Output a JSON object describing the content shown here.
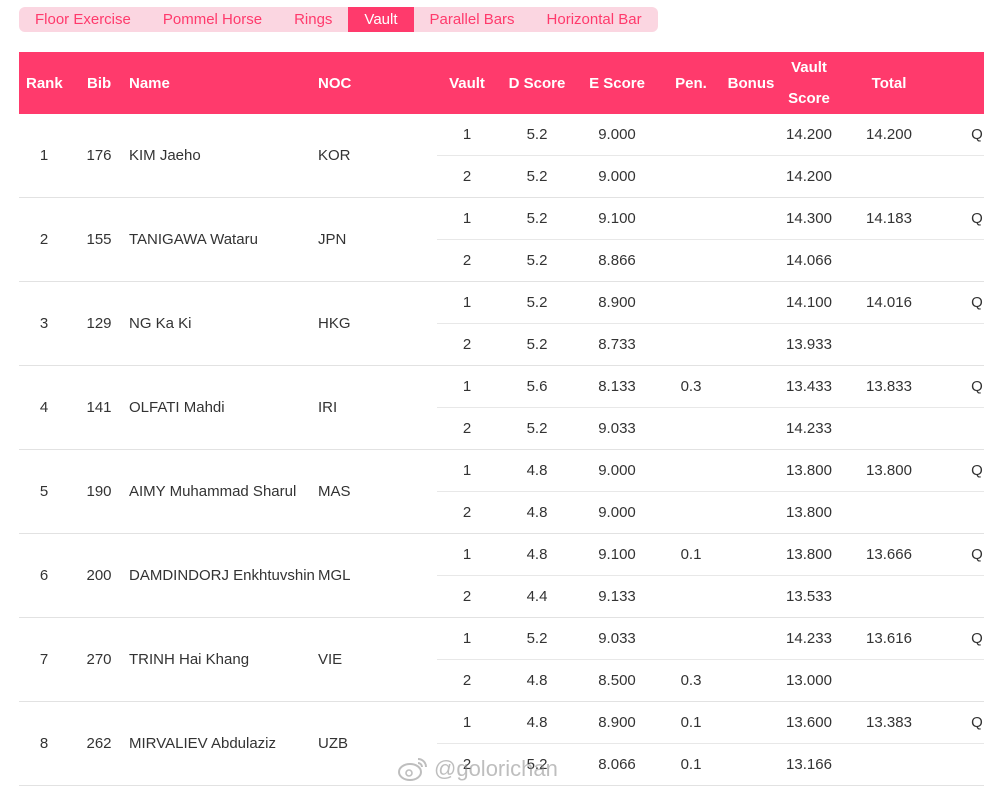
{
  "tabs": [
    {
      "label": "Floor Exercise",
      "active": false
    },
    {
      "label": "Pommel Horse",
      "active": false
    },
    {
      "label": "Rings",
      "active": false
    },
    {
      "label": "Vault",
      "active": true
    },
    {
      "label": "Parallel Bars",
      "active": false
    },
    {
      "label": "Horizontal Bar",
      "active": false
    }
  ],
  "header": {
    "rank": "Rank",
    "bib": "Bib",
    "name": "Name",
    "noc": "NOC",
    "vault": "Vault",
    "d_score": "D Score",
    "e_score": "E Score",
    "pen": "Pen.",
    "bonus": "Bonus",
    "vault_score_line1": "Vault",
    "vault_score_line2": "Score",
    "total": "Total"
  },
  "rows": [
    {
      "rank": "1",
      "bib": "176",
      "name": "KIM Jaeho",
      "noc": "KOR",
      "total": "14.200",
      "qual": "Q",
      "vaults": [
        {
          "vault": "1",
          "d": "5.2",
          "e": "9.000",
          "pen": "",
          "bonus": "",
          "score": "14.200"
        },
        {
          "vault": "2",
          "d": "5.2",
          "e": "9.000",
          "pen": "",
          "bonus": "",
          "score": "14.200"
        }
      ]
    },
    {
      "rank": "2",
      "bib": "155",
      "name": "TANIGAWA Wataru",
      "noc": "JPN",
      "total": "14.183",
      "qual": "Q",
      "vaults": [
        {
          "vault": "1",
          "d": "5.2",
          "e": "9.100",
          "pen": "",
          "bonus": "",
          "score": "14.300"
        },
        {
          "vault": "2",
          "d": "5.2",
          "e": "8.866",
          "pen": "",
          "bonus": "",
          "score": "14.066"
        }
      ]
    },
    {
      "rank": "3",
      "bib": "129",
      "name": "NG Ka Ki",
      "noc": "HKG",
      "total": "14.016",
      "qual": "Q",
      "vaults": [
        {
          "vault": "1",
          "d": "5.2",
          "e": "8.900",
          "pen": "",
          "bonus": "",
          "score": "14.100"
        },
        {
          "vault": "2",
          "d": "5.2",
          "e": "8.733",
          "pen": "",
          "bonus": "",
          "score": "13.933"
        }
      ]
    },
    {
      "rank": "4",
      "bib": "141",
      "name": "OLFATI Mahdi",
      "noc": "IRI",
      "total": "13.833",
      "qual": "Q",
      "vaults": [
        {
          "vault": "1",
          "d": "5.6",
          "e": "8.133",
          "pen": "0.3",
          "bonus": "",
          "score": "13.433"
        },
        {
          "vault": "2",
          "d": "5.2",
          "e": "9.033",
          "pen": "",
          "bonus": "",
          "score": "14.233"
        }
      ]
    },
    {
      "rank": "5",
      "bib": "190",
      "name": "AIMY Muhammad Sharul",
      "noc": "MAS",
      "total": "13.800",
      "qual": "Q",
      "vaults": [
        {
          "vault": "1",
          "d": "4.8",
          "e": "9.000",
          "pen": "",
          "bonus": "",
          "score": "13.800"
        },
        {
          "vault": "2",
          "d": "4.8",
          "e": "9.000",
          "pen": "",
          "bonus": "",
          "score": "13.800"
        }
      ]
    },
    {
      "rank": "6",
      "bib": "200",
      "name": "DAMDINDORJ Enkhtuvshin",
      "noc": "MGL",
      "total": "13.666",
      "qual": "Q",
      "vaults": [
        {
          "vault": "1",
          "d": "4.8",
          "e": "9.100",
          "pen": "0.1",
          "bonus": "",
          "score": "13.800"
        },
        {
          "vault": "2",
          "d": "4.4",
          "e": "9.133",
          "pen": "",
          "bonus": "",
          "score": "13.533"
        }
      ]
    },
    {
      "rank": "7",
      "bib": "270",
      "name": "TRINH Hai Khang",
      "noc": "VIE",
      "total": "13.616",
      "qual": "Q",
      "vaults": [
        {
          "vault": "1",
          "d": "5.2",
          "e": "9.033",
          "pen": "",
          "bonus": "",
          "score": "14.233"
        },
        {
          "vault": "2",
          "d": "4.8",
          "e": "8.500",
          "pen": "0.3",
          "bonus": "",
          "score": "13.000"
        }
      ]
    },
    {
      "rank": "8",
      "bib": "262",
      "name": "MIRVALIEV Abdulaziz",
      "noc": "UZB",
      "total": "13.383",
      "qual": "Q",
      "vaults": [
        {
          "vault": "1",
          "d": "4.8",
          "e": "8.900",
          "pen": "0.1",
          "bonus": "",
          "score": "13.600"
        },
        {
          "vault": "2",
          "d": "5.2",
          "e": "8.066",
          "pen": "0.1",
          "bonus": "",
          "score": "13.166"
        }
      ]
    }
  ],
  "watermark": {
    "text": "@golorichan",
    "icon": "weibo-icon"
  },
  "colors": {
    "accent": "#ff3a6c",
    "tab_bg": "#fbd6e1"
  }
}
